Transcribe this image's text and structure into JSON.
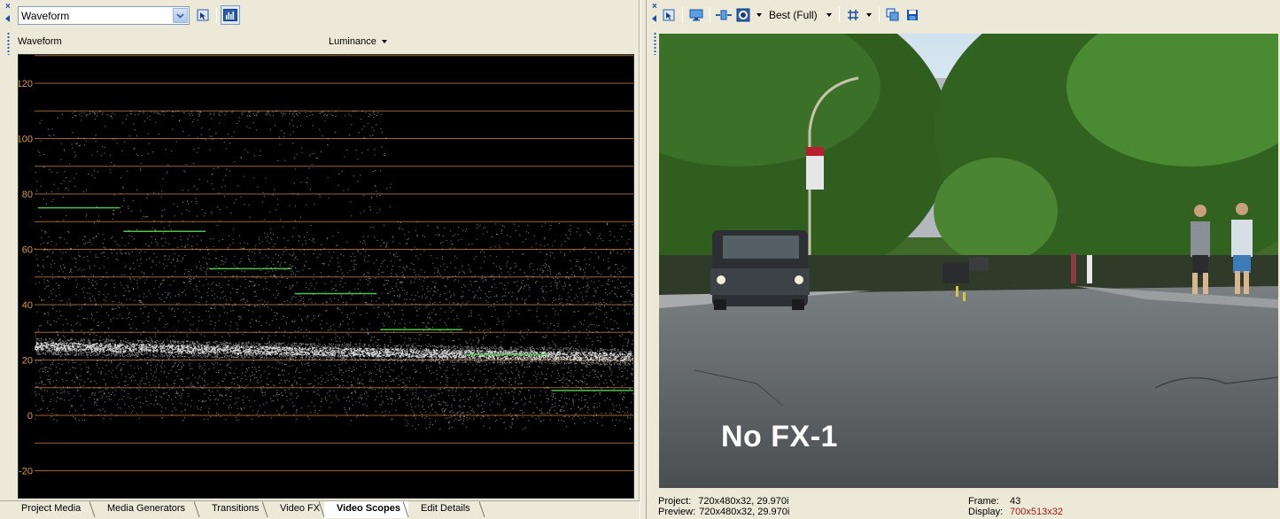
{
  "scope_panel": {
    "scope_type_selected": "Waveform",
    "scope_title": "Waveform",
    "mode_selected": "Luminance",
    "y_axis_ticks": [
      "120",
      "100",
      "80",
      "60",
      "40",
      "20",
      "0",
      "-20"
    ],
    "grid_color": "#c08040",
    "tick_color": "#d89a40"
  },
  "tabs": [
    {
      "label": "Project Media"
    },
    {
      "label": "Media Generators"
    },
    {
      "label": "Transitions"
    },
    {
      "label": "Video FX"
    },
    {
      "label": "Video Scopes"
    },
    {
      "label": "Edit Details"
    }
  ],
  "preview_panel": {
    "quality": "Best (Full)",
    "overlay_text": "No FX-1",
    "status": {
      "project_label": "Project:",
      "project_value": "720x480x32, 29.970i",
      "preview_label": "Preview:",
      "preview_value": "720x480x32, 29.970i",
      "frame_label": "Frame:",
      "frame_value": "43",
      "display_label": "Display:",
      "display_value": "700x513x32"
    }
  },
  "colors": {
    "accent": "#1a4ea8",
    "panel_bg": "#ece9d8",
    "display_value": "#a01818"
  }
}
